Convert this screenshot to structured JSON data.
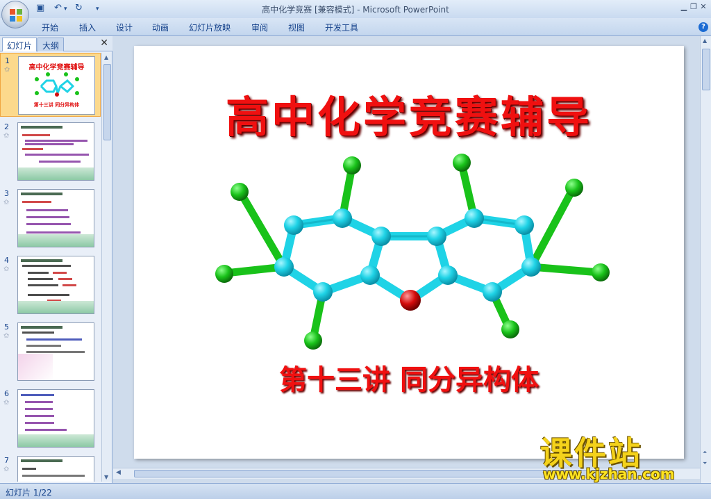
{
  "window": {
    "title": "高中化学竞赛 [兼容模式] - Microsoft PowerPoint"
  },
  "ribbon": {
    "tabs": [
      "开始",
      "插入",
      "设计",
      "动画",
      "幻灯片放映",
      "审阅",
      "视图",
      "开发工具"
    ]
  },
  "pane": {
    "tab_slides": "幻灯片",
    "tab_outline": "大纲",
    "thumbnails": [
      {
        "num": "1",
        "title": "高中化学竞赛辅导",
        "subtitle": "第十三讲 同分异构体"
      },
      {
        "num": "2"
      },
      {
        "num": "3"
      },
      {
        "num": "4"
      },
      {
        "num": "5"
      },
      {
        "num": "6"
      },
      {
        "num": "7"
      }
    ]
  },
  "slide": {
    "title": "高中化学竞赛辅导",
    "subtitle": "第十三讲 同分异构体"
  },
  "status": {
    "text": "幻灯片 1/22"
  },
  "watermark": {
    "brand": "课件站",
    "url": "www.kjzhan.com"
  },
  "colors": {
    "title_red": "#f01010",
    "bond_cyan": "#1fd3e6",
    "atom_green": "#19c21a",
    "atom_oxygen": "#d40c0c"
  }
}
